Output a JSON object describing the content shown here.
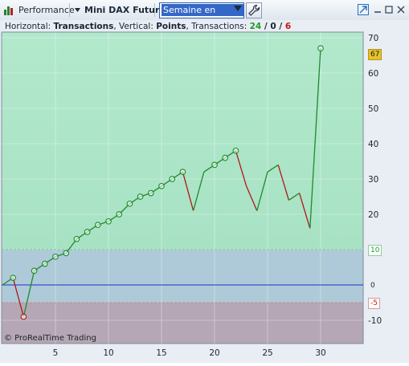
{
  "toolbar": {
    "performance_label": "Performance",
    "instrument_label": "Mini DAX Future",
    "period_select": "Semaine en cours"
  },
  "header": {
    "horizontal_prefix": "Horizontal: ",
    "horizontal_value": "Transactions",
    "vertical_prefix": ", Vertical: ",
    "vertical_value": "Points",
    "transactions_prefix": ", Transactions: ",
    "wins": "24",
    "slash1": " / ",
    "neutral": "0",
    "slash2": " / ",
    "losses": "6"
  },
  "watermark": "© ProRealTime Trading",
  "colors": {
    "upper_zone": "#a8e2c4",
    "lower_zone": "#aecad8",
    "loss_zone": "#b5a7b5",
    "up_segment": "#1e8b2c",
    "down_segment": "#b01818",
    "zero_line": "#1a2fd0",
    "win_count": "#1f9b2a",
    "loss_count": "#c21818"
  },
  "chart_data": {
    "type": "line",
    "xlabel": "Transactions",
    "ylabel": "Points",
    "xlim": [
      0,
      34
    ],
    "ylim": [
      -15,
      74
    ],
    "x_ticks": [
      5,
      10,
      15,
      20,
      25,
      30
    ],
    "y_ticks": [
      -10,
      0,
      10,
      20,
      30,
      40,
      50,
      60,
      70
    ],
    "reference_levels": {
      "upper": 10,
      "zero": 0,
      "lower": -5
    },
    "reference_labels": {
      "upper": "10",
      "zero": "0",
      "lower": "-5"
    },
    "last_value_label": "67",
    "series": [
      {
        "x": [
          0,
          1,
          2,
          3,
          4,
          5,
          6,
          7,
          8,
          9,
          10,
          11,
          12,
          13,
          14,
          15,
          16,
          17,
          18,
          19,
          20,
          21,
          22,
          23,
          24,
          25,
          26,
          27,
          28,
          29,
          30
        ],
        "y": [
          0,
          2,
          -9,
          4,
          6,
          8,
          9,
          13,
          15,
          17,
          18,
          20,
          23,
          25,
          26,
          28,
          30,
          32,
          21,
          32,
          34,
          36,
          38,
          28,
          21,
          32,
          34,
          24,
          26,
          16,
          67
        ],
        "marked_x": [
          1,
          2,
          3,
          4,
          5,
          6,
          7,
          8,
          9,
          10,
          11,
          12,
          13,
          14,
          15,
          16,
          17,
          20,
          21,
          22,
          30
        ]
      }
    ]
  }
}
